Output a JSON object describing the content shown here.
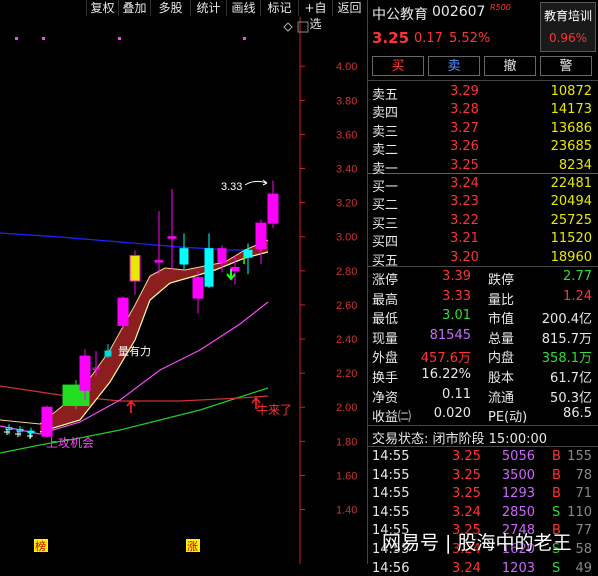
{
  "toolbar": {
    "items": [
      "复权",
      "叠加",
      "多股",
      "统计",
      "画线",
      "标记",
      "+自选",
      "返回"
    ]
  },
  "chart": {
    "y_ticks": [
      "4.00",
      "3.80",
      "3.60",
      "3.40",
      "3.20",
      "3.00",
      "2.80",
      "2.60",
      "2.40",
      "2.20",
      "2.00",
      "1.80",
      "1.60",
      "1.40"
    ],
    "annotations": {
      "high_label": "3.33",
      "a1": "量有力",
      "a2": "牛来了",
      "a3": "上攻机会"
    },
    "bottom_tags": [
      "榜",
      "涨"
    ],
    "colors": {
      "up": "#ff00ff",
      "down": "#00ffff",
      "ma_blue": "#2222ff",
      "ma_white": "#ffff99",
      "ma_pink": "#ff44ff",
      "ma_green": "#22cc22",
      "ma_red": "#cc3333"
    }
  },
  "chart_data": {
    "type": "candlestick",
    "ylim": [
      1.28,
      4.06
    ],
    "candles": [
      {
        "o": 1.88,
        "c": 1.87,
        "h": 1.9,
        "l": 1.84
      },
      {
        "o": 1.87,
        "c": 1.86,
        "h": 1.89,
        "l": 1.83
      },
      {
        "o": 1.86,
        "c": 1.85,
        "h": 1.88,
        "l": 1.82
      },
      {
        "o": 1.83,
        "c": 2.0,
        "h": 2.01,
        "l": 1.82
      },
      {
        "o": 2.01,
        "c": 2.13,
        "h": 2.16,
        "l": 1.99
      },
      {
        "o": 2.1,
        "c": 2.3,
        "h": 2.34,
        "l": 2.04
      },
      {
        "o": 2.23,
        "c": 2.23,
        "h": 2.33,
        "l": 2.18
      },
      {
        "o": 2.3,
        "c": 2.33,
        "h": 2.37,
        "l": 2.29
      },
      {
        "o": 2.48,
        "c": 2.64,
        "h": 2.65,
        "l": 2.46
      },
      {
        "o": 2.74,
        "c": 2.89,
        "h": 2.92,
        "l": 2.66
      },
      {
        "o": 2.86,
        "c": 2.86,
        "h": 3.15,
        "l": 2.78
      },
      {
        "o": 3.0,
        "c": 3.0,
        "h": 3.28,
        "l": 2.81
      },
      {
        "o": 2.93,
        "c": 2.84,
        "h": 3.02,
        "l": 2.81
      },
      {
        "o": 2.64,
        "c": 2.76,
        "h": 2.8,
        "l": 2.55
      },
      {
        "o": 2.93,
        "c": 2.71,
        "h": 3.02,
        "l": 2.7
      },
      {
        "o": 2.85,
        "c": 2.93,
        "h": 2.95,
        "l": 2.79
      },
      {
        "o": 2.8,
        "c": 2.82,
        "h": 2.89,
        "l": 2.72
      },
      {
        "o": 2.92,
        "c": 2.88,
        "h": 2.96,
        "l": 2.78
      },
      {
        "o": 2.93,
        "c": 3.08,
        "h": 3.1,
        "l": 2.84
      },
      {
        "o": 3.08,
        "c": 3.25,
        "h": 3.33,
        "l": 3.05
      }
    ]
  },
  "stock": {
    "name": "中公教育",
    "code": "002607",
    "badge": "R500",
    "concept": "教育培训",
    "price": "3.25",
    "change": "0.17",
    "pct": "5.52%",
    "concept_pct": "0.96%"
  },
  "trade_buttons": [
    "买",
    "卖",
    "撤",
    "警"
  ],
  "asks": [
    {
      "label": "卖五",
      "price": "3.29",
      "vol": "10872"
    },
    {
      "label": "卖四",
      "price": "3.28",
      "vol": "14173"
    },
    {
      "label": "卖三",
      "price": "3.27",
      "vol": "13686"
    },
    {
      "label": "卖二",
      "price": "3.26",
      "vol": "23685"
    },
    {
      "label": "卖一",
      "price": "3.25",
      "vol": "8234"
    }
  ],
  "bids": [
    {
      "label": "买一",
      "price": "3.24",
      "vol": "22481"
    },
    {
      "label": "买二",
      "price": "3.23",
      "vol": "20494"
    },
    {
      "label": "买三",
      "price": "3.22",
      "vol": "25725"
    },
    {
      "label": "买四",
      "price": "3.21",
      "vol": "11520"
    },
    {
      "label": "买五",
      "price": "3.20",
      "vol": "18960"
    }
  ],
  "stats": [
    {
      "k1": "涨停",
      "v1": "3.39",
      "k2": "跌停",
      "v2": "2.77"
    },
    {
      "k1": "最高",
      "v1": "3.33",
      "k2": "量比",
      "v2": "1.24"
    },
    {
      "k1": "最低",
      "v1": "3.01",
      "k2": "市值",
      "v2": "200.4亿"
    },
    {
      "k1": "现量",
      "v1": "81545",
      "k2": "总量",
      "v2": "815.7万"
    },
    {
      "k1": "外盘",
      "v1": "457.6万",
      "k2": "内盘",
      "v2": "358.1万"
    },
    {
      "k1": "换手",
      "v1": "16.22%",
      "k2": "股本",
      "v2": "61.7亿"
    },
    {
      "k1": "净资",
      "v1": "0.11",
      "k2": "流通",
      "v2": "50.3亿"
    },
    {
      "k1": "收益㈡",
      "v1": "0.020",
      "k2": "PE(动)",
      "v2": "86.5"
    }
  ],
  "trade_status": "交易状态: 闭市阶段 15:00:00",
  "ticks": [
    {
      "t": "14:55",
      "p": "3.25",
      "v": "5056",
      "s": "B",
      "n": "155"
    },
    {
      "t": "14:55",
      "p": "3.25",
      "v": "3500",
      "s": "B",
      "n": "78"
    },
    {
      "t": "14:55",
      "p": "3.25",
      "v": "1293",
      "s": "B",
      "n": "71"
    },
    {
      "t": "14:55",
      "p": "3.24",
      "v": "2850",
      "s": "S",
      "n": "110"
    },
    {
      "t": "14:55",
      "p": "3.25",
      "v": "2748",
      "s": "B",
      "n": "77"
    },
    {
      "t": "14:55",
      "p": "3.24",
      "v": "1620",
      "s": "S",
      "n": "58"
    },
    {
      "t": "14:56",
      "p": "3.24",
      "v": "1203",
      "s": "S",
      "n": "49"
    }
  ],
  "watermark": "网易号 | 股海中的老王"
}
